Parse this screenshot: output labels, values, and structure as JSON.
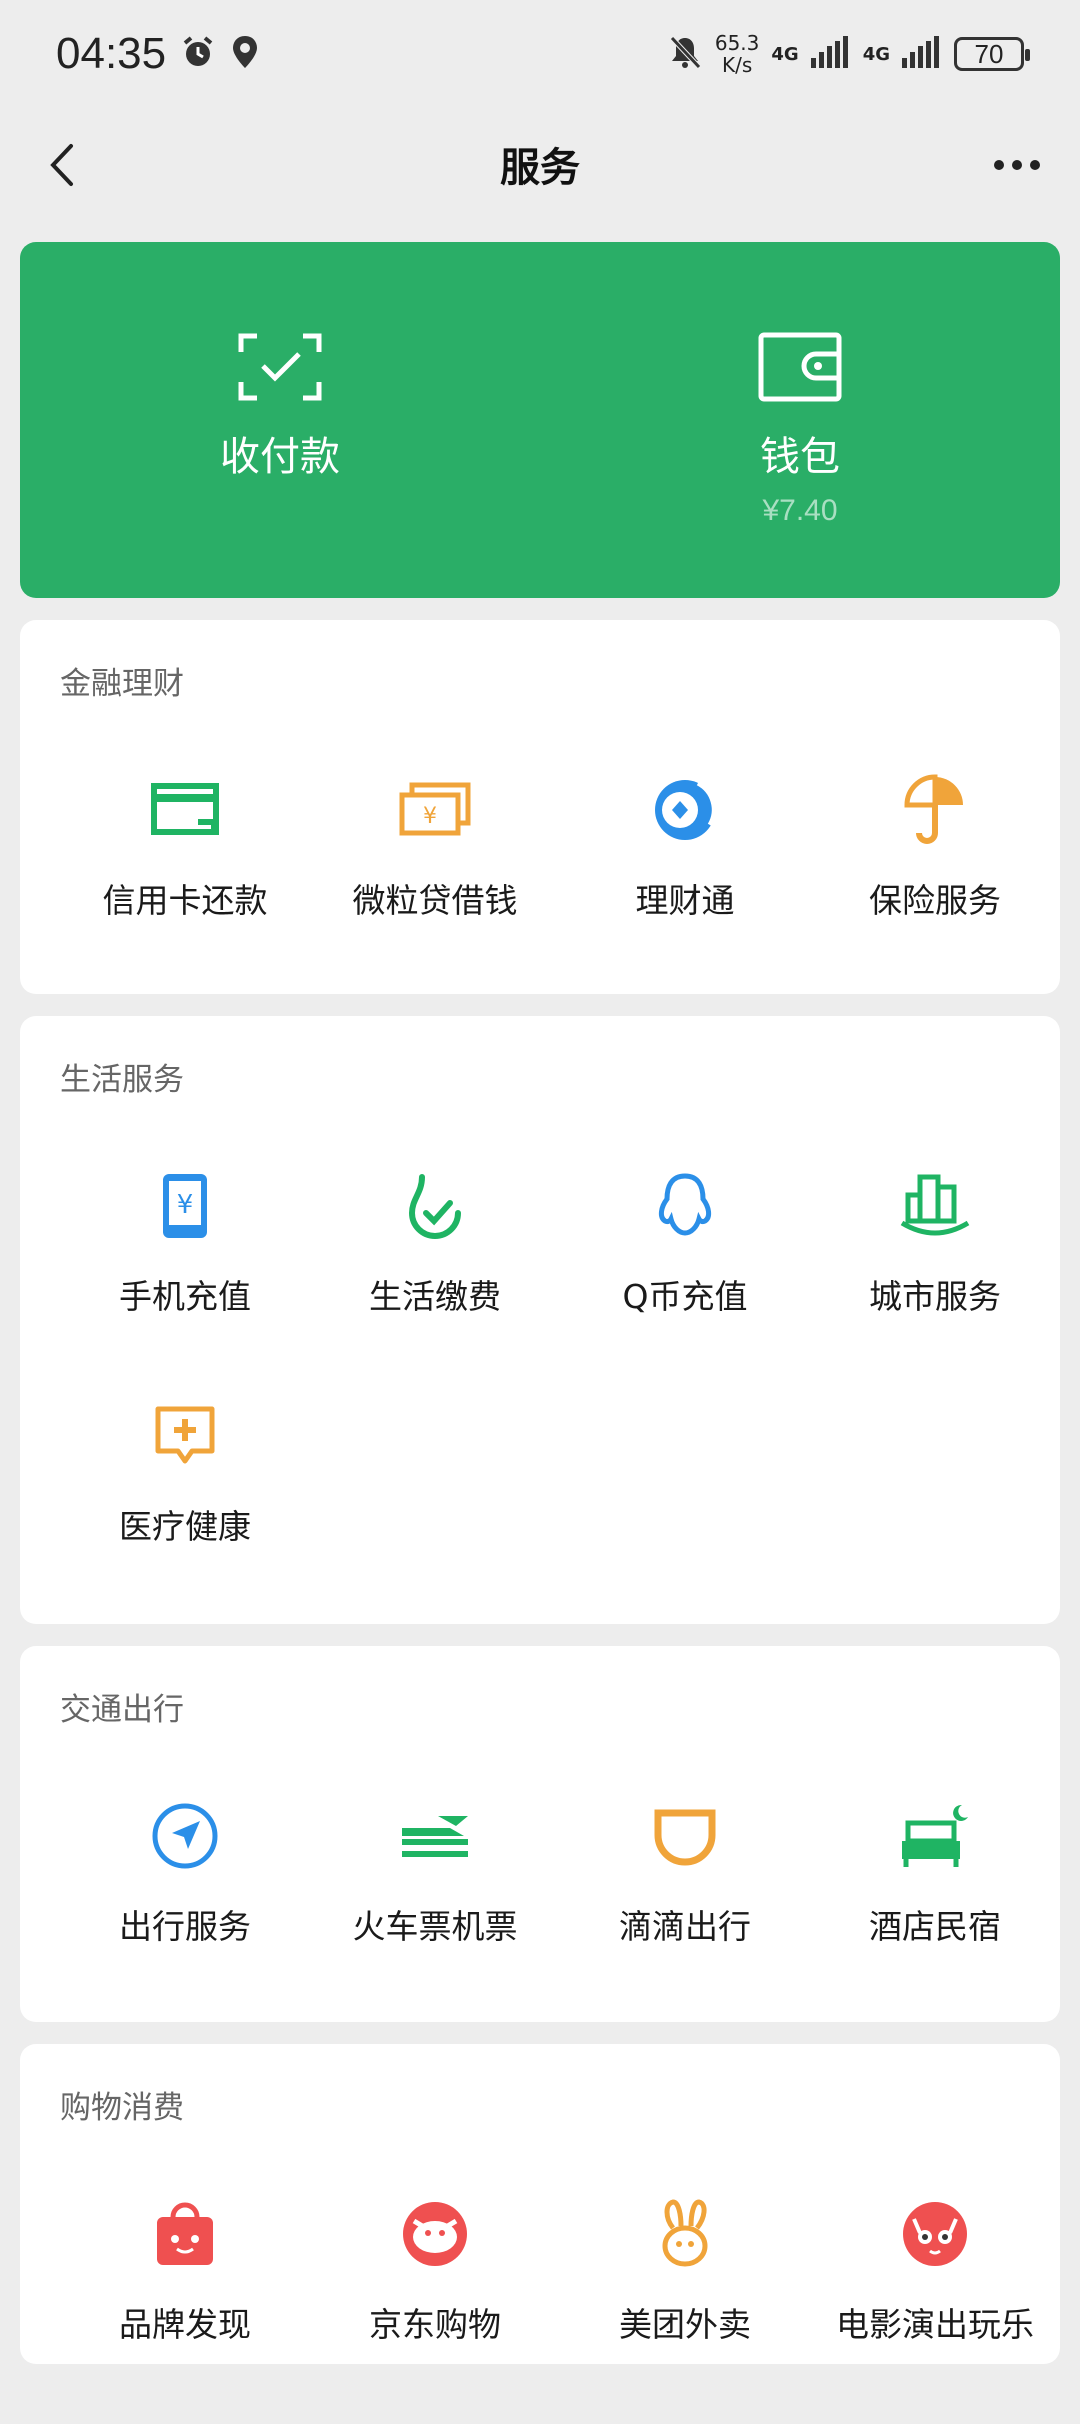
{
  "status": {
    "time": "04:35",
    "netspeed_top": "65.3",
    "netspeed_bottom": "K/s",
    "net1": "4G",
    "net2": "4G",
    "battery": "70"
  },
  "nav": {
    "title": "服务"
  },
  "hero": {
    "pay_label": "收付款",
    "wallet_label": "钱包",
    "wallet_balance": "¥7.40"
  },
  "sections": [
    {
      "title": "金融理财",
      "items": [
        {
          "label": "信用卡还款",
          "icon": "credit-card-icon"
        },
        {
          "label": "微粒贷借钱",
          "icon": "loan-icon"
        },
        {
          "label": "理财通",
          "icon": "wealth-icon"
        },
        {
          "label": "保险服务",
          "icon": "insurance-icon"
        }
      ]
    },
    {
      "title": "生活服务",
      "items": [
        {
          "label": "手机充值",
          "icon": "phone-topup-icon"
        },
        {
          "label": "生活缴费",
          "icon": "utility-bill-icon"
        },
        {
          "label": "Q币充值",
          "icon": "qq-coin-icon"
        },
        {
          "label": "城市服务",
          "icon": "city-service-icon"
        },
        {
          "label": "医疗健康",
          "icon": "medical-icon"
        }
      ]
    },
    {
      "title": "交通出行",
      "items": [
        {
          "label": "出行服务",
          "icon": "travel-icon"
        },
        {
          "label": "火车票机票",
          "icon": "train-plane-icon"
        },
        {
          "label": "滴滴出行",
          "icon": "didi-icon"
        },
        {
          "label": "酒店民宿",
          "icon": "hotel-icon"
        }
      ]
    },
    {
      "title": "购物消费",
      "items": [
        {
          "label": "品牌发现",
          "icon": "brand-bag-icon"
        },
        {
          "label": "京东购物",
          "icon": "jd-icon"
        },
        {
          "label": "美团外卖",
          "icon": "meituan-icon"
        },
        {
          "label": "电影演出玩乐",
          "icon": "movie-cat-icon"
        }
      ]
    }
  ]
}
